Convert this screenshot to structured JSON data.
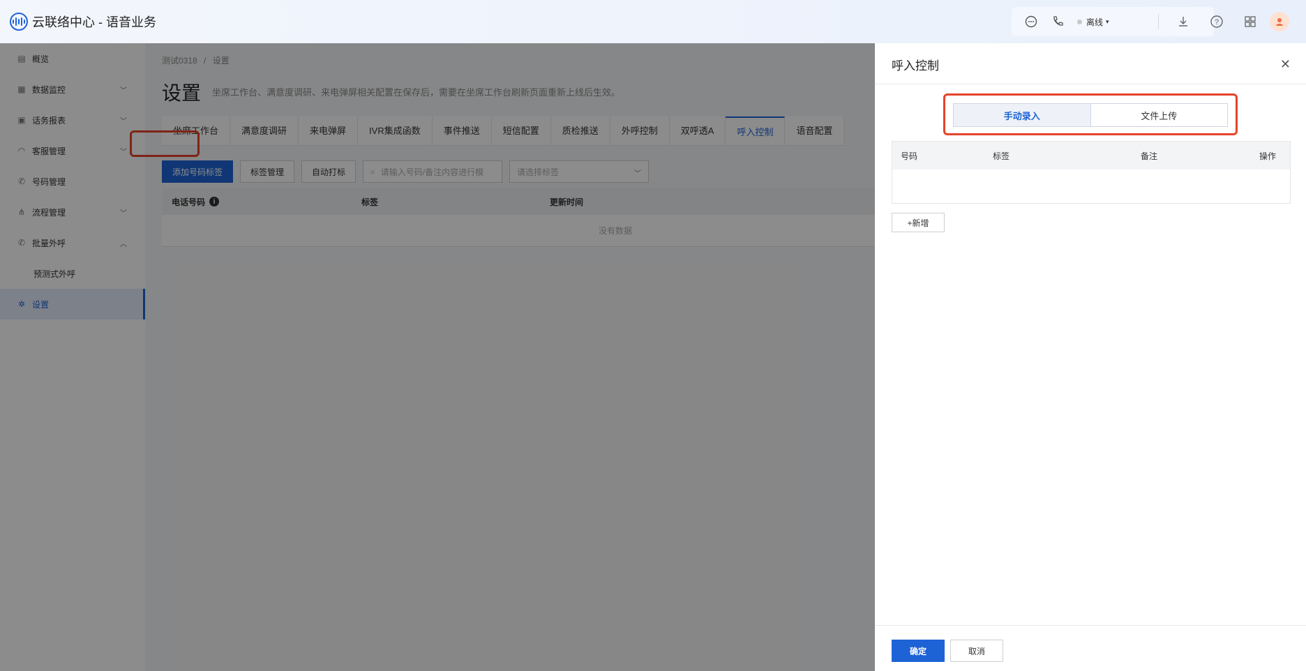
{
  "app": {
    "title": "云联络中心 - 语音业务"
  },
  "topbar": {
    "status_label": "离线"
  },
  "sidebar": {
    "items": [
      {
        "label": "概览",
        "icon": "overview-icon"
      },
      {
        "label": "数据监控",
        "icon": "monitor-icon",
        "expandable": true
      },
      {
        "label": "话务报表",
        "icon": "report-icon",
        "expandable": true
      },
      {
        "label": "客服管理",
        "icon": "headset-icon",
        "expandable": true
      },
      {
        "label": "号码管理",
        "icon": "phone-icon"
      },
      {
        "label": "流程管理",
        "icon": "flow-icon",
        "expandable": true
      },
      {
        "label": "批量外呼",
        "icon": "phone-icon",
        "expandable": true,
        "expanded": true
      },
      {
        "label": "预测式外呼",
        "sub": true
      },
      {
        "label": "设置",
        "icon": "gear-icon",
        "active": true
      }
    ]
  },
  "page": {
    "breadcrumb_root": "测试0318",
    "breadcrumb_sep": "/",
    "breadcrumb_current": "设置",
    "title": "设置",
    "description": "坐席工作台、满意度调研、来电弹屏相关配置在保存后，需要在坐席工作台刷新页面重新上线后生效。",
    "tabs": [
      "坐席工作台",
      "满意度调研",
      "来电弹屏",
      "IVR集成函数",
      "事件推送",
      "短信配置",
      "质检推送",
      "外呼控制",
      "双呼透A",
      "呼入控制",
      "语音配置"
    ],
    "active_tab": "呼入控制",
    "toolbar": {
      "add_label": "添加号码标签",
      "manage_label": "标签管理",
      "auto_label": "自动打标",
      "search_placeholder": "请输入号码/备注内容进行模",
      "select_placeholder": "请选择标签"
    },
    "table": {
      "columns": [
        "电话号码",
        "标签",
        "更新时间"
      ],
      "empty_text": "没有数据"
    }
  },
  "drawer": {
    "title": "呼入控制",
    "segments": [
      "手动录入",
      "文件上传"
    ],
    "active_segment": "手动录入",
    "columns": [
      "号码",
      "标签",
      "备注",
      "操作"
    ],
    "add_label": "+新增",
    "confirm_label": "确定",
    "cancel_label": "取消"
  },
  "colors": {
    "accent": "#1e63d6",
    "highlight": "#e5432a"
  }
}
